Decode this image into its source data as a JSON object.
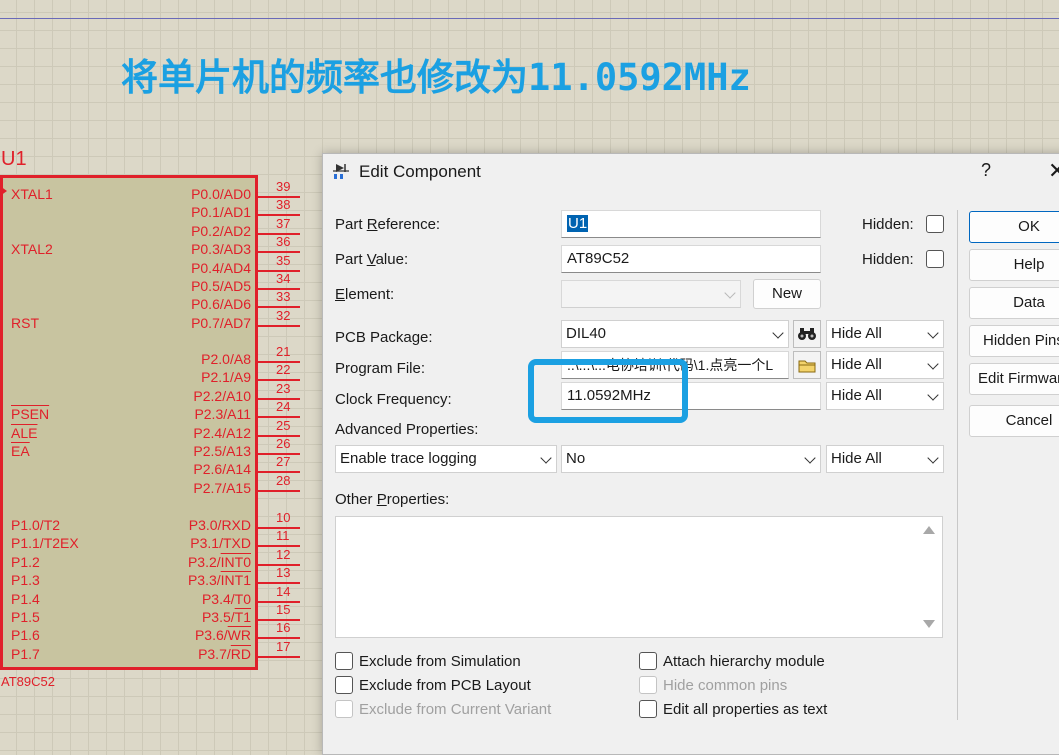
{
  "banner": "将单片机的频率也修改为11.0592MHz",
  "chip": {
    "ref": "U1",
    "part": "AT89C52",
    "left_pins": [
      {
        "label": "XTAL1"
      },
      {
        "label": "XTAL2"
      },
      {
        "label": "RST"
      },
      {
        "label": "PSEN"
      },
      {
        "label": "ALE"
      },
      {
        "label": "EA"
      },
      {
        "label": "P1.0/T2"
      },
      {
        "label": "P1.1/T2EX"
      },
      {
        "label": "P1.2"
      },
      {
        "label": "P1.3"
      },
      {
        "label": "P1.4"
      },
      {
        "label": "P1.5"
      },
      {
        "label": "P1.6"
      },
      {
        "label": "P1.7"
      }
    ],
    "right_pins": [
      {
        "label": "P0.0/AD0",
        "num": "39"
      },
      {
        "label": "P0.1/AD1",
        "num": "38"
      },
      {
        "label": "P0.2/AD2",
        "num": "37"
      },
      {
        "label": "P0.3/AD3",
        "num": "36"
      },
      {
        "label": "P0.4/AD4",
        "num": "35"
      },
      {
        "label": "P0.5/AD5",
        "num": "34"
      },
      {
        "label": "P0.6/AD6",
        "num": "33"
      },
      {
        "label": "P0.7/AD7",
        "num": "32"
      },
      {
        "label": "P2.0/A8",
        "num": "21"
      },
      {
        "label": "P2.1/A9",
        "num": "22"
      },
      {
        "label": "P2.2/A10",
        "num": "23"
      },
      {
        "label": "P2.3/A11",
        "num": "24"
      },
      {
        "label": "P2.4/A12",
        "num": "25"
      },
      {
        "label": "P2.5/A13",
        "num": "26"
      },
      {
        "label": "P2.6/A14",
        "num": "27"
      },
      {
        "label": "P2.7/A15",
        "num": "28"
      },
      {
        "label": "P3.0/RXD",
        "num": "10"
      },
      {
        "label": "P3.1/TXD",
        "num": "11"
      },
      {
        "label": "P3.2/INT0",
        "num": "12"
      },
      {
        "label": "P3.3/INT1",
        "num": "13"
      },
      {
        "label": "P3.4/T0",
        "num": "14"
      },
      {
        "label": "P3.5/T1",
        "num": "15"
      },
      {
        "label": "P3.6/WR",
        "num": "16"
      },
      {
        "label": "P3.7/RD",
        "num": "17"
      }
    ]
  },
  "dialog": {
    "title": "Edit Component",
    "help": "?",
    "close": "✕",
    "part_reference": {
      "label_pre": "Part ",
      "label_u": "R",
      "label_post": "eference:",
      "value": "U1"
    },
    "part_value": {
      "label_pre": "Part ",
      "label_u": "V",
      "label_post": "alue:",
      "value": "AT89C52"
    },
    "element": {
      "label_u": "E",
      "label_post": "lement:",
      "value": ""
    },
    "new_button": "New",
    "hidden_label": "Hidden:",
    "pcb_package": {
      "label": "PCB Package:",
      "value": "DIL40",
      "visibility": "Hide All"
    },
    "program_file": {
      "label": "Program File:",
      "value": "..\\...\\...电协培训\\代码\\1.点亮一个L",
      "visibility": "Hide All"
    },
    "clock_frequency": {
      "label": "Clock Frequency:",
      "value": "11.0592MHz",
      "visibility": "Hide All"
    },
    "advanced_properties": {
      "label": "Advanced Properties:",
      "property": "Enable trace logging",
      "value": "No",
      "visibility": "Hide All"
    },
    "other_properties": {
      "label_pre": "Other ",
      "label_u": "P",
      "label_post": "roperties:"
    },
    "checkboxes": {
      "exclude_simulation": "Exclude from Simulation",
      "exclude_pcb": "Exclude from PCB Layout",
      "exclude_variant": "Exclude from Current Variant",
      "attach_hierarchy": "Attach hierarchy module",
      "hide_common_pins": "Hide common pins",
      "edit_as_text": "Edit all properties as text"
    },
    "buttons": {
      "ok": "OK",
      "help": "Help",
      "data": "Data",
      "hidden_pins": "Hidden Pins",
      "edit_firmware": "Edit Firmware",
      "cancel": "Cancel"
    }
  }
}
